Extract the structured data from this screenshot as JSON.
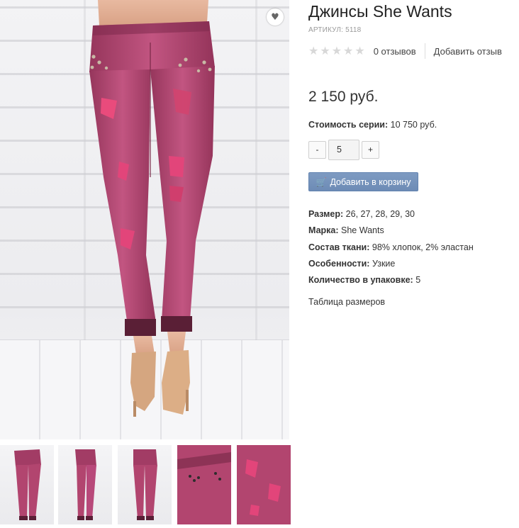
{
  "product": {
    "title": "Джинсы She Wants",
    "sku_label": "АРТИКУЛ:",
    "sku_value": "5118",
    "rating_stars": 0,
    "rating_max": 5,
    "reviews_count_text": "0 отзывов",
    "add_review_text": "Добавить отзыв",
    "price": "2 150 руб.",
    "series_label": "Стоимость серии:",
    "series_value": "10 750 руб.",
    "quantity": "5",
    "minus_label": "-",
    "plus_label": "+",
    "add_to_cart_label": "Добавить в корзину",
    "cart_icon": "shopping-cart-icon",
    "favorite_icon": "heart-icon",
    "size_table_link": "Таблица размеров"
  },
  "properties": [
    {
      "label": "Размер:",
      "value": "26, 27, 28, 29, 30"
    },
    {
      "label": "Марка:",
      "value": "She Wants"
    },
    {
      "label": "Состав ткани:",
      "value": "98% хлопок, 2% эластан"
    },
    {
      "label": "Особенности:",
      "value": "Узкие"
    },
    {
      "label": "Количество в упаковке:",
      "value": "5"
    }
  ],
  "gallery": {
    "thumbnail_count": 5
  },
  "colors": {
    "button_blue": "#7290bb",
    "denim_pink": "#b2456f",
    "star_empty": "#d8d8d8"
  }
}
